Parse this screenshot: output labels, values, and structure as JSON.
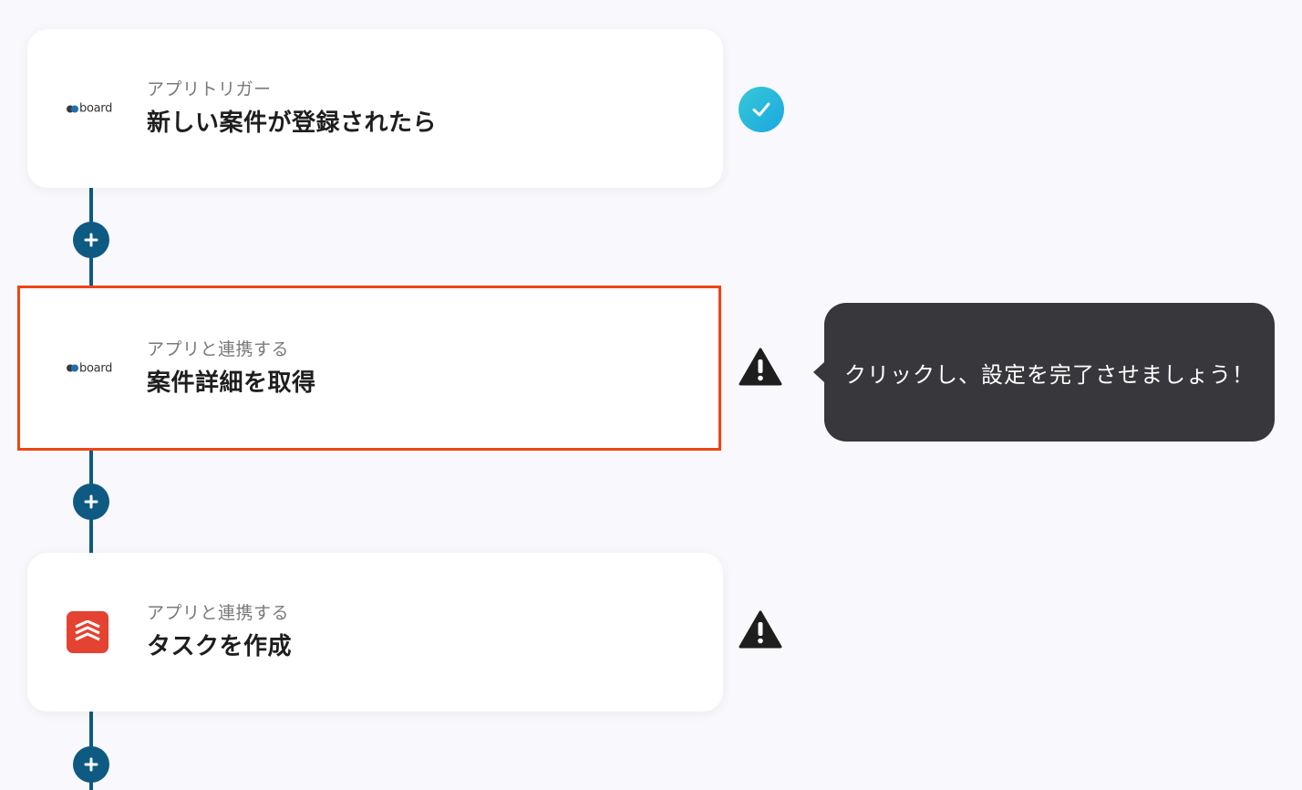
{
  "flow": {
    "steps": [
      {
        "subtitle": "アプリトリガー",
        "title": "新しい案件が登録されたら",
        "app_logo": "board",
        "status": "complete"
      },
      {
        "subtitle": "アプリと連携する",
        "title": "案件詳細を取得",
        "app_logo": "board",
        "status": "warning"
      },
      {
        "subtitle": "アプリと連携する",
        "title": "タスクを作成",
        "app_logo": "todoist",
        "status": "warning"
      }
    ],
    "logo_text": "board"
  },
  "tooltip": {
    "text": "クリックし、設定を完了させましょう！"
  },
  "icons": {
    "complete": "check-circle-icon",
    "warning": "warning-triangle-icon",
    "add": "plus-circle-icon",
    "todoist": "todoist-logo-icon"
  },
  "colors": {
    "connector": "#0e5a83",
    "highlight": "#f04414",
    "check": "#1aa7e0",
    "tooltip_bg": "#38373b",
    "todoist": "#e44332"
  }
}
